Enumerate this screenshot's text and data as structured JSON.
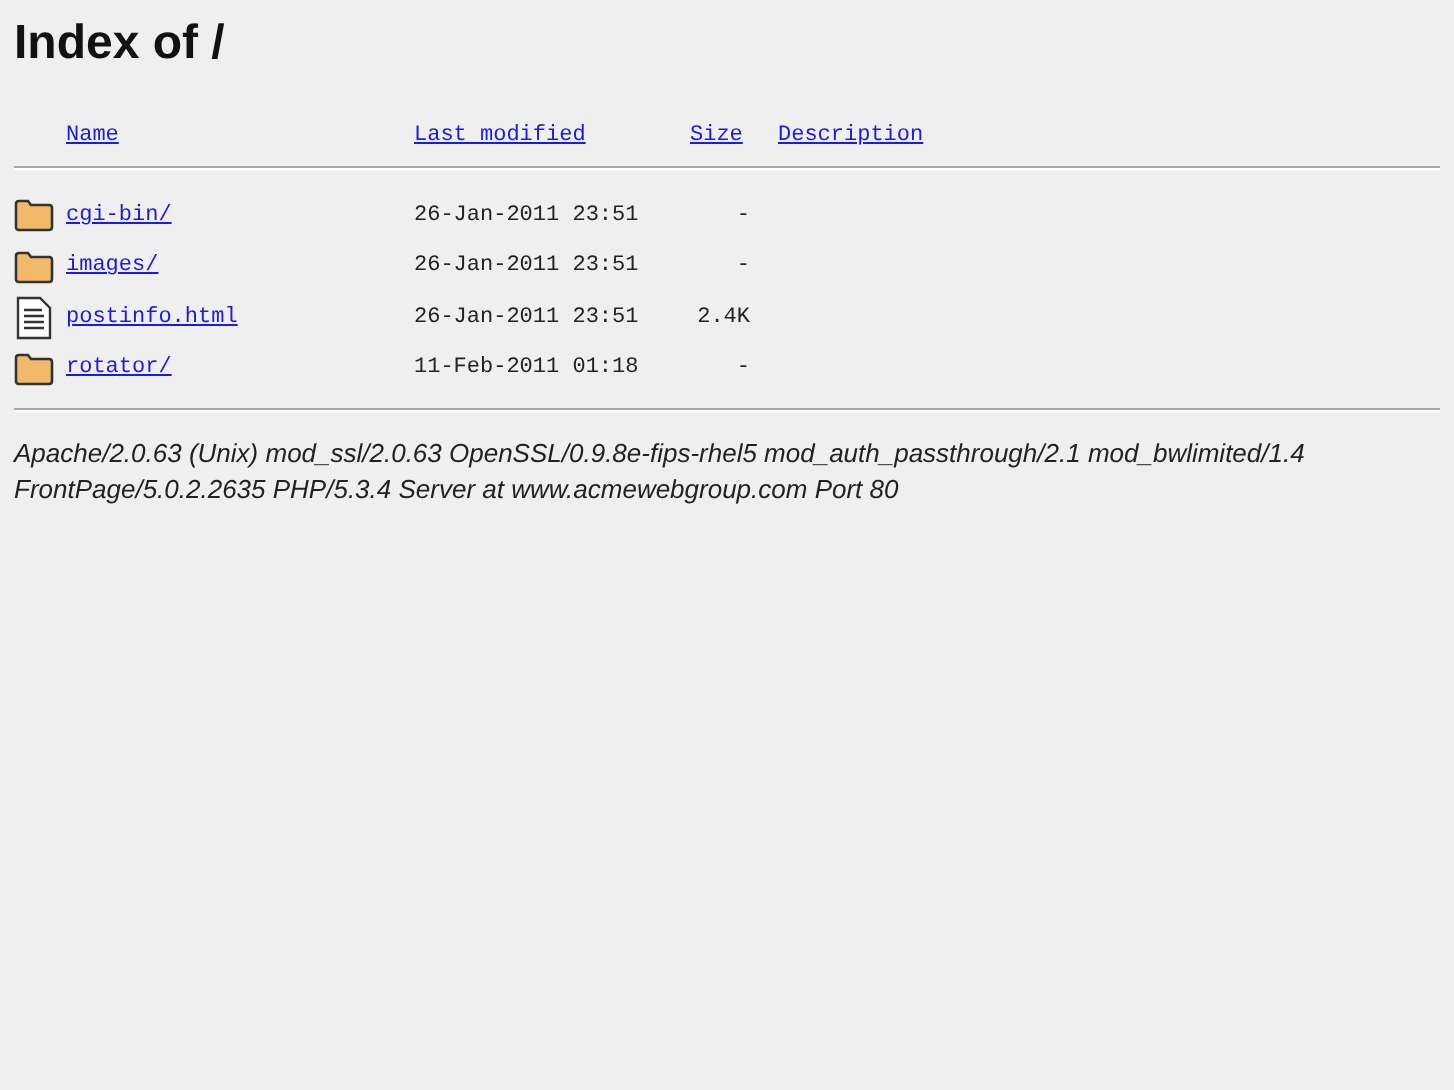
{
  "title": "Index of /",
  "columns": [
    "Name",
    "Last modified",
    "Size",
    "Description"
  ],
  "rows": [
    {
      "kind": "folder",
      "name": "cgi-bin/",
      "modified": "26-Jan-2011 23:51",
      "size": "-"
    },
    {
      "kind": "folder",
      "name": "images/",
      "modified": "26-Jan-2011 23:51",
      "size": "-"
    },
    {
      "kind": "file",
      "name": "postinfo.html",
      "modified": "26-Jan-2011 23:51",
      "size": "2.4K"
    },
    {
      "kind": "folder",
      "name": "rotator/",
      "modified": "11-Feb-2011 01:18",
      "size": "-"
    }
  ],
  "address": "Apache/2.0.63 (Unix) mod_ssl/2.0.63 OpenSSL/0.9.8e-fips-rhel5 mod_auth_passthrough/2.1 mod_bwlimited/1.4 FrontPage/5.0.2.2635 PHP/5.3.4 Server at www.acmewebgroup.com Port 80"
}
